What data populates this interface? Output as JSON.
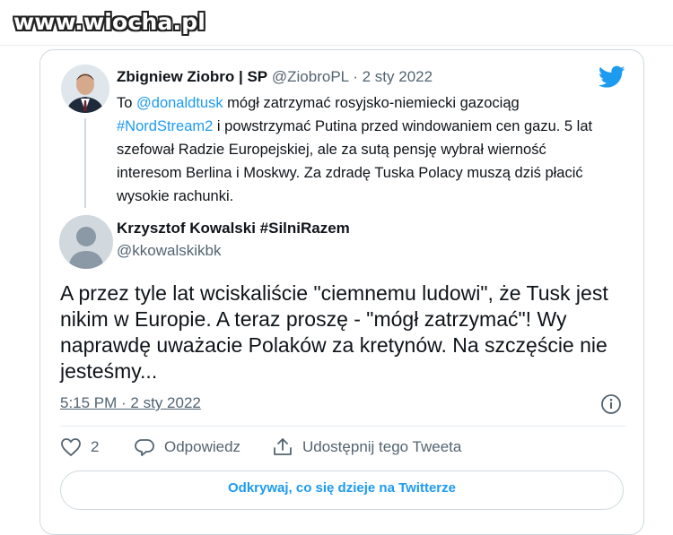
{
  "watermark": "www.wiocha.pl",
  "original_tweet": {
    "name": "Zbigniew Ziobro | SP",
    "handle": "@ZiobroPL",
    "separator": "·",
    "date": "2 sty 2022",
    "text_prefix": "To ",
    "mention": "@donaldtusk",
    "text_mid": " mógł zatrzymać rosyjsko-niemiecki gazociąg ",
    "hashtag": "#NordStream2",
    "text_suffix": " i powstrzymać Putina przed windowaniem cen gazu. 5 lat szefował Radzie Europejskiej, ale za sutą pensję wybrał wierność interesom Berlina i Moskwy. Za zdradę Tuska Polacy muszą dziś płacić wysokie rachunki."
  },
  "reply_tweet": {
    "name": "Krzysztof Kowalski #SilniRazem",
    "handle": "@kkowalskikbk",
    "text": "A przez tyle lat wciskaliście \"ciemnemu ludowi\", że Tusk jest nikim w Europie. A teraz proszę - \"mógł zatrzymać\"! Wy naprawdę uważacie Polaków za kretynów. Na szczęście nie jesteśmy...",
    "timestamp": "5:15 PM · 2 sty 2022"
  },
  "actions": {
    "like_count": "2",
    "reply_label": "Odpowiedz",
    "share_label": "Udostępnij tego Tweeta"
  },
  "explore_button": "Odkrywaj, co się dzieje na Twitterze",
  "colors": {
    "accent": "#1d9bf0",
    "text": "#0f1419",
    "muted": "#536471",
    "border": "#cfd9de"
  }
}
